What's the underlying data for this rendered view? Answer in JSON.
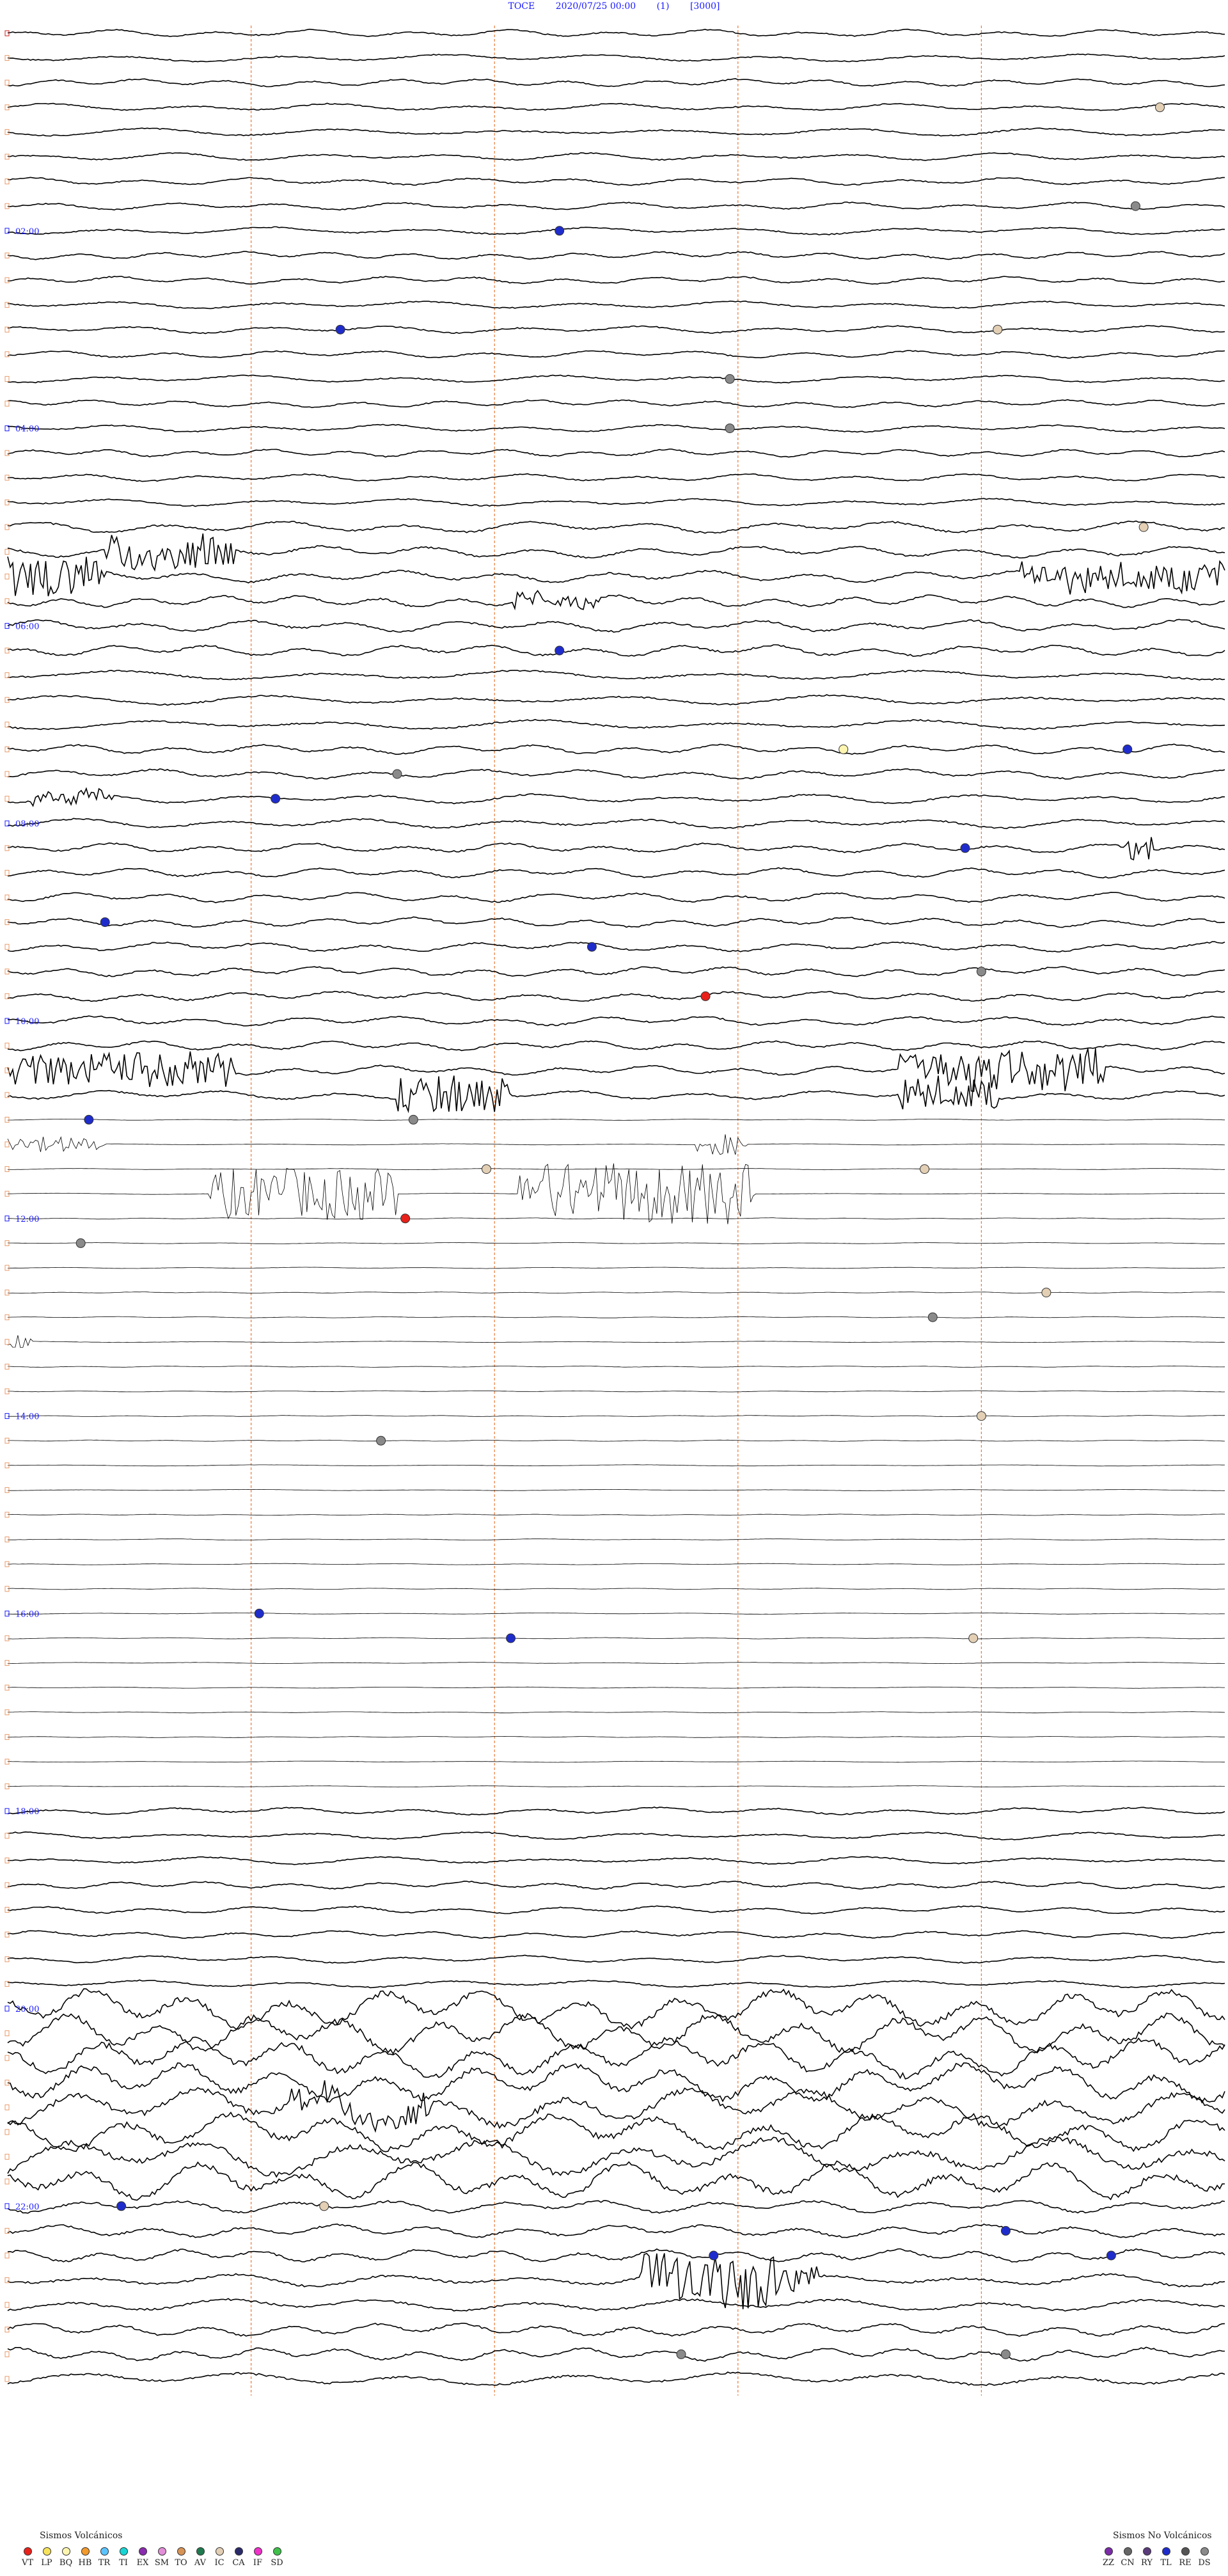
{
  "header": {
    "station": "TOCE",
    "datetime": "2020/07/25 00:00",
    "channel": "(1)",
    "scale": "[3000]"
  },
  "chart_data": {
    "type": "helicorder",
    "x_minutes_per_line": 15,
    "lines_total": 96,
    "hour_labels": [
      {
        "hour": 0,
        "text": ""
      },
      {
        "hour": 2,
        "text": "02:00"
      },
      {
        "hour": 4,
        "text": "04:00"
      },
      {
        "hour": 6,
        "text": "06:00"
      },
      {
        "hour": 8,
        "text": "08:00"
      },
      {
        "hour": 10,
        "text": "10:00"
      },
      {
        "hour": 12,
        "text": "12:00"
      },
      {
        "hour": 14,
        "text": "14:00"
      },
      {
        "hour": 16,
        "text": "16:00"
      },
      {
        "hour": 18,
        "text": "18:00"
      },
      {
        "hour": 20,
        "text": "20:00"
      },
      {
        "hour": 22,
        "text": "22:00"
      }
    ],
    "minute_markers": [
      3,
      6,
      9,
      12
    ],
    "events": [
      {
        "line": 3,
        "minute": 14.2,
        "type": "IC"
      },
      {
        "line": 7,
        "minute": 13.9,
        "type": "DS"
      },
      {
        "line": 8,
        "minute": 6.8,
        "type": "TL"
      },
      {
        "line": 12,
        "minute": 4.1,
        "type": "TL"
      },
      {
        "line": 12,
        "minute": 12.2,
        "type": "IC"
      },
      {
        "line": 14,
        "minute": 8.9,
        "type": "DS"
      },
      {
        "line": 16,
        "minute": 8.9,
        "type": "DS"
      },
      {
        "line": 20,
        "minute": 14.0,
        "type": "IC"
      },
      {
        "line": 25,
        "minute": 6.8,
        "type": "TL"
      },
      {
        "line": 29,
        "minute": 10.3,
        "type": "BQ"
      },
      {
        "line": 29,
        "minute": 13.8,
        "type": "TL"
      },
      {
        "line": 30,
        "minute": 4.8,
        "type": "DS"
      },
      {
        "line": 31,
        "minute": 3.3,
        "type": "TL"
      },
      {
        "line": 33,
        "minute": 11.8,
        "type": "TL"
      },
      {
        "line": 36,
        "minute": 1.2,
        "type": "TL"
      },
      {
        "line": 37,
        "minute": 7.2,
        "type": "TL"
      },
      {
        "line": 38,
        "minute": 12.0,
        "type": "DS"
      },
      {
        "line": 39,
        "minute": 8.6,
        "type": "VT"
      },
      {
        "line": 44,
        "minute": 1.0,
        "type": "TL"
      },
      {
        "line": 44,
        "minute": 5.0,
        "type": "DS"
      },
      {
        "line": 46,
        "minute": 5.9,
        "type": "IC"
      },
      {
        "line": 46,
        "minute": 11.3,
        "type": "IC"
      },
      {
        "line": 48,
        "minute": 4.9,
        "type": "VT"
      },
      {
        "line": 49,
        "minute": 0.9,
        "type": "DS"
      },
      {
        "line": 51,
        "minute": 12.8,
        "type": "IC"
      },
      {
        "line": 52,
        "minute": 11.4,
        "type": "DS"
      },
      {
        "line": 56,
        "minute": 12.0,
        "type": "IC"
      },
      {
        "line": 57,
        "minute": 4.6,
        "type": "DS"
      },
      {
        "line": 64,
        "minute": 3.1,
        "type": "TL"
      },
      {
        "line": 65,
        "minute": 6.2,
        "type": "TL"
      },
      {
        "line": 65,
        "minute": 11.9,
        "type": "IC"
      },
      {
        "line": 88,
        "minute": 1.4,
        "type": "TL"
      },
      {
        "line": 88,
        "minute": 3.9,
        "type": "IC"
      },
      {
        "line": 89,
        "minute": 12.3,
        "type": "TL"
      },
      {
        "line": 90,
        "minute": 13.6,
        "type": "TL"
      },
      {
        "line": 90,
        "minute": 8.7,
        "type": "TL"
      },
      {
        "line": 94,
        "minute": 8.3,
        "type": "DS"
      },
      {
        "line": 94,
        "minute": 12.3,
        "type": "DS"
      }
    ],
    "legend_volcanic": {
      "title": "Sismos Volcánicos",
      "items": [
        {
          "code": "VT",
          "color": "#e8211b"
        },
        {
          "code": "LP",
          "color": "#f7e35b"
        },
        {
          "code": "BQ",
          "color": "#fdf5b0"
        },
        {
          "code": "HB",
          "color": "#f39a2c"
        },
        {
          "code": "TR",
          "color": "#5cc3ff"
        },
        {
          "code": "TI",
          "color": "#18d5d5"
        },
        {
          "code": "EX",
          "color": "#8a2bb0"
        },
        {
          "code": "SM",
          "color": "#e28fd8"
        },
        {
          "code": "TO",
          "color": "#d89356"
        },
        {
          "code": "AV",
          "color": "#1f7a4f"
        },
        {
          "code": "IC",
          "color": "#e3cfb4"
        },
        {
          "code": "CA",
          "color": "#2a2a6a"
        },
        {
          "code": "IF",
          "color": "#ef30c9"
        },
        {
          "code": "SD",
          "color": "#3ec04a"
        }
      ]
    },
    "legend_nonvolcanic": {
      "title": "Sismos No Volcánicos",
      "items": [
        {
          "code": "ZZ",
          "color": "#7b2aa8"
        },
        {
          "code": "CN",
          "color": "#666666"
        },
        {
          "code": "RY",
          "color": "#5a3b7a"
        },
        {
          "code": "TL",
          "color": "#1f2ccc"
        },
        {
          "code": "RE",
          "color": "#555555"
        },
        {
          "code": "DS",
          "color": "#8a8a8a"
        }
      ]
    }
  },
  "colors": {
    "header_text": "#1a1aff",
    "trace": "#000000",
    "minute_marker": "#e87a3a",
    "hour_label": "#1a1aff"
  }
}
